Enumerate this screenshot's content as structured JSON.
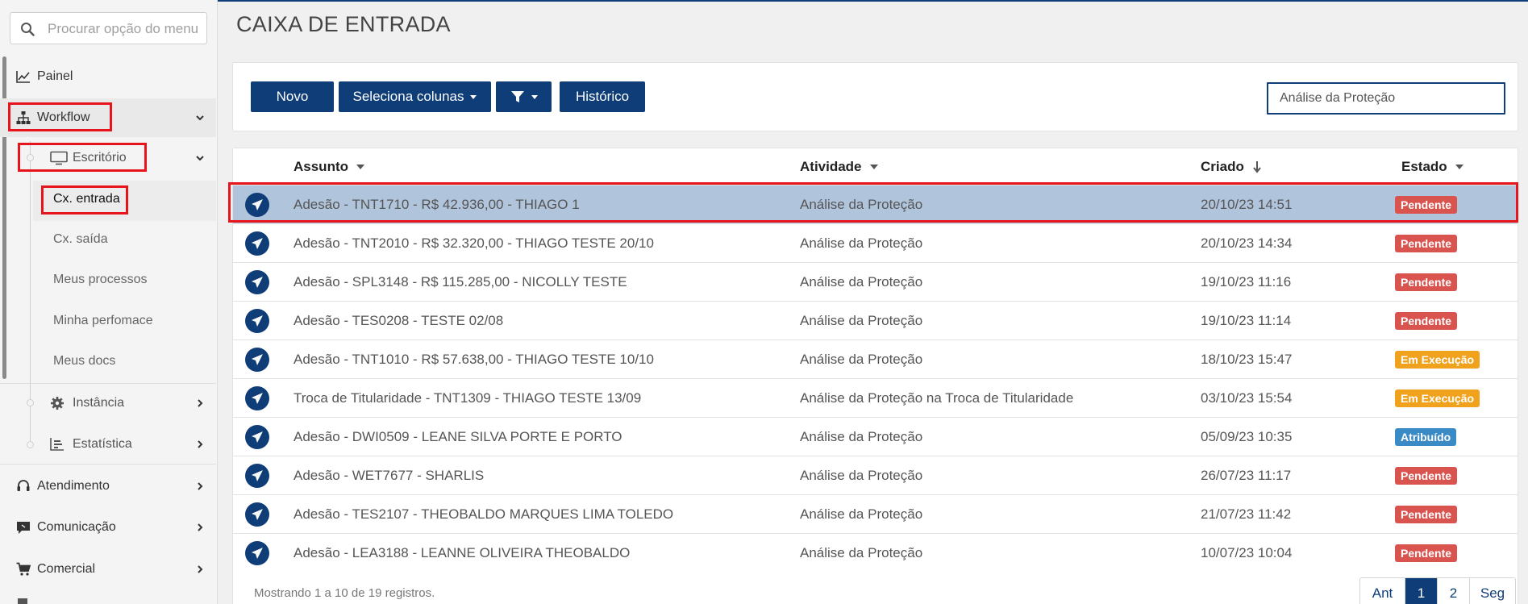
{
  "search": {
    "placeholder": "Procurar opção do menu"
  },
  "sidebar": {
    "painel": "Painel",
    "workflow": "Workflow",
    "escritorio": "Escritório",
    "cx_entrada": "Cx. entrada",
    "cx_saida": "Cx. saída",
    "meus_processos": "Meus processos",
    "minha_perfomace": "Minha perfomace",
    "meus_docs": "Meus docs",
    "instancia": "Instância",
    "estatistica": "Estatística",
    "atendimento": "Atendimento",
    "comunicacao": "Comunicação",
    "comercial": "Comercial"
  },
  "page": {
    "title": "CAIXA DE ENTRADA"
  },
  "toolbar": {
    "novo": "Novo",
    "seleciona_colunas": "Seleciona colunas",
    "historico": "Histórico",
    "filter_value": "Análise da Proteção"
  },
  "table": {
    "headers": {
      "assunto": "Assunto",
      "atividade": "Atividade",
      "criado": "Criado",
      "estado": "Estado"
    },
    "rows": [
      {
        "assunto": "Adesão - TNT1710 - R$ 42.936,00 - THIAGO 1",
        "atividade": "Análise da Proteção",
        "criado": "20/10/23 14:51",
        "estado": "Pendente"
      },
      {
        "assunto": "Adesão - TNT2010 - R$ 32.320,00 - THIAGO TESTE 20/10",
        "atividade": "Análise da Proteção",
        "criado": "20/10/23 14:34",
        "estado": "Pendente"
      },
      {
        "assunto": "Adesão - SPL3148 - R$ 115.285,00 - NICOLLY TESTE",
        "atividade": "Análise da Proteção",
        "criado": "19/10/23 11:16",
        "estado": "Pendente"
      },
      {
        "assunto": "Adesão - TES0208 - TESTE 02/08",
        "atividade": "Análise da Proteção",
        "criado": "19/10/23 11:14",
        "estado": "Pendente"
      },
      {
        "assunto": "Adesão - TNT1010 - R$ 57.638,00 - THIAGO TESTE 10/10",
        "atividade": "Análise da Proteção",
        "criado": "18/10/23 15:47",
        "estado": "Em Execução"
      },
      {
        "assunto": "Troca de Titularidade - TNT1309 - THIAGO TESTE 13/09",
        "atividade": "Análise da Proteção na Troca de Titularidade",
        "criado": "03/10/23 15:54",
        "estado": "Em Execução"
      },
      {
        "assunto": "Adesão - DWI0509 - LEANE SILVA PORTE E PORTO",
        "atividade": "Análise da Proteção",
        "criado": "05/09/23 10:35",
        "estado": "Atribuído"
      },
      {
        "assunto": "Adesão - WET7677 - SHARLIS",
        "atividade": "Análise da Proteção",
        "criado": "26/07/23 11:17",
        "estado": "Pendente"
      },
      {
        "assunto": "Adesão - TES2107 - THEOBALDO MARQUES LIMA TOLEDO",
        "atividade": "Análise da Proteção",
        "criado": "21/07/23 11:42",
        "estado": "Pendente"
      },
      {
        "assunto": "Adesão - LEA3188 - LEANNE OLIVEIRA THEOBALDO",
        "atividade": "Análise da Proteção",
        "criado": "10/07/23 10:04",
        "estado": "Pendente"
      }
    ],
    "footer": "Mostrando 1 a 10 de 19 registros."
  },
  "pager": {
    "prev": "Ant",
    "p1": "1",
    "p2": "2",
    "next": "Seg"
  },
  "colors": {
    "primary": "#0f3d78",
    "pendente": "#d9534f",
    "execucao": "#f0a21c",
    "atribuido": "#3a8ac5",
    "highlight": "#e8141b",
    "selected_row": "#b0c4dc"
  },
  "icons": {
    "doc": "paper-plane-icon"
  }
}
